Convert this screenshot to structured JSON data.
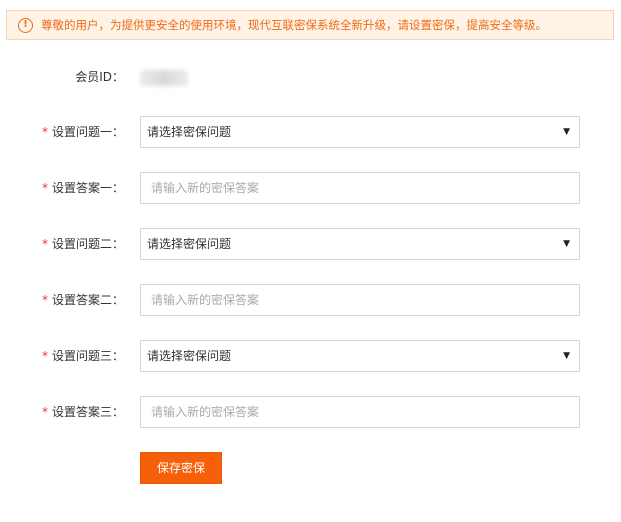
{
  "notice": {
    "icon": "exclamation-circle-icon",
    "text": "尊敬的用户，为提供更安全的使用环境，现代互联密保系统全新升级，请设置密保，提高安全等级。",
    "color": "#f06b13"
  },
  "member": {
    "label": "会员ID："
  },
  "form": {
    "required_mark": "*",
    "question1": {
      "label": "设置问题一：",
      "selected": "请选择密保问题"
    },
    "answer1": {
      "label": "设置答案一：",
      "placeholder": "请输入新的密保答案"
    },
    "question2": {
      "label": "设置问题二：",
      "selected": "请选择密保问题"
    },
    "answer2": {
      "label": "设置答案二：",
      "placeholder": "请输入新的密保答案"
    },
    "question3": {
      "label": "设置问题三：",
      "selected": "请选择密保问题"
    },
    "answer3": {
      "label": "设置答案三：",
      "placeholder": "请输入新的密保答案"
    },
    "dropdown_arrow": "▼"
  },
  "actions": {
    "save_label": "保存密保",
    "accent_color": "#f7600a"
  }
}
